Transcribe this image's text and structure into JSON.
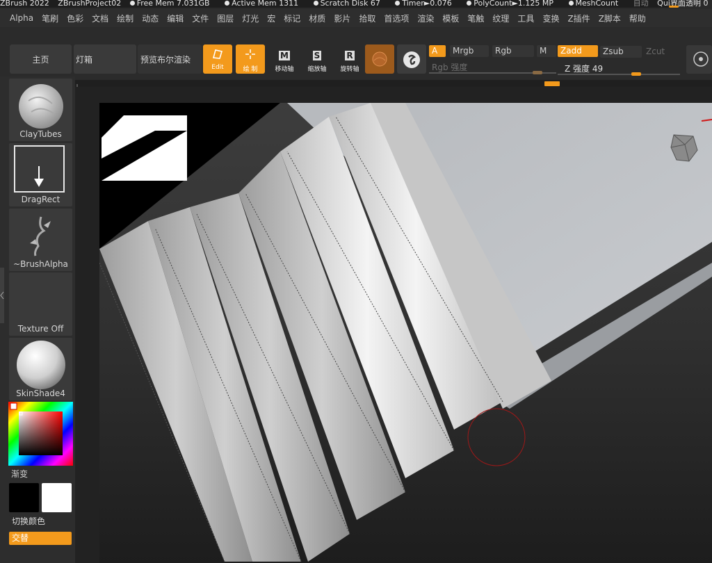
{
  "titlebar": {
    "app": "ZBrush 2022",
    "project": "ZBrushProject02",
    "free_mem": "Free Mem 7.031GB",
    "active_mem": "Active Mem 1311",
    "scratch": "Scratch Disk 67",
    "timer": "Timer►0.076",
    "polycount": "PolyCount►1.125 MP",
    "meshcount": "MeshCount",
    "auto": "自动",
    "quicksave": "QuickSave",
    "transparency": "界面透明 0"
  },
  "menu": [
    "Alpha",
    "笔刷",
    "色彩",
    "文档",
    "绘制",
    "动态",
    "编辑",
    "文件",
    "图层",
    "灯光",
    "宏",
    "标记",
    "材质",
    "影片",
    "拾取",
    "首选项",
    "渲染",
    "模板",
    "笔触",
    "纹理",
    "工具",
    "变换",
    "Z插件",
    "Z脚本",
    "帮助"
  ],
  "shelf": {
    "home": "主页",
    "lightbox": "灯箱",
    "bpr": "预览布尔渲染",
    "edit": "Edit",
    "draw": "绘 制",
    "move": "移动轴",
    "scale": "缩放轴",
    "rotate": "旋转轴",
    "move_key": "M",
    "scale_key": "S",
    "rotate_key": "R"
  },
  "color_modes": {
    "a": "A",
    "mrgb": "Mrgb",
    "rgb": "Rgb",
    "m": "M"
  },
  "z_modes": {
    "zadd": "Zadd",
    "zsub": "Zsub",
    "zcut": "Zcut"
  },
  "sliders": {
    "rgb_label": "Rgb 强度",
    "rgb_level": 0.85,
    "z_label": "Z 强度 49",
    "z_level": 0.64
  },
  "left": {
    "brush": "ClayTubes",
    "stroke": "DragRect",
    "alpha": "~BrushAlpha",
    "texture": "Texture Off",
    "material": "SkinShade4",
    "gradient": "渐变",
    "switch_color": "切换颜色",
    "alternate": "交替"
  },
  "colors": {
    "accent": "#f39a1c",
    "main_color": "#000000",
    "secondary_color": "#ffffff"
  }
}
